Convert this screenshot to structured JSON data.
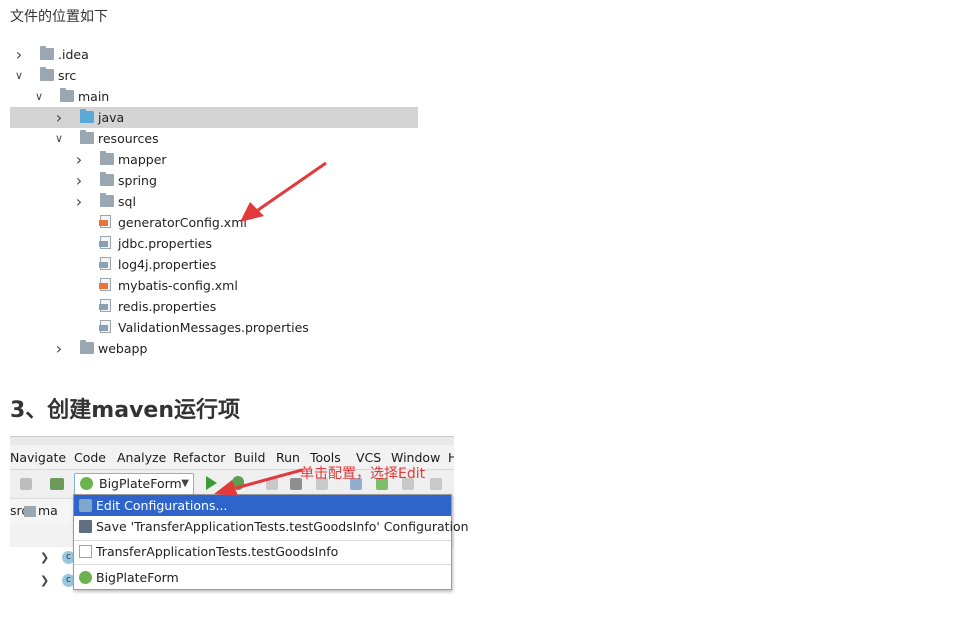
{
  "intro_text": "文件的位置如下",
  "tree": [
    {
      "label": ".idea",
      "icon": "folder-icon",
      "expanded": false,
      "depth": 0
    },
    {
      "label": "src",
      "icon": "folder-icon",
      "expanded": true,
      "depth": 0
    },
    {
      "label": "main",
      "icon": "folder-icon",
      "expanded": true,
      "depth": 1
    },
    {
      "label": "java",
      "icon": "source-folder-icon",
      "expanded": false,
      "depth": 2,
      "selected": true
    },
    {
      "label": "resources",
      "icon": "resources-folder-icon",
      "expanded": true,
      "depth": 2
    },
    {
      "label": "mapper",
      "icon": "folder-icon",
      "expanded": false,
      "depth": 3
    },
    {
      "label": "spring",
      "icon": "folder-icon",
      "expanded": false,
      "depth": 3
    },
    {
      "label": "sql",
      "icon": "folder-icon",
      "expanded": false,
      "depth": 3
    },
    {
      "label": "generatorConfig.xml",
      "icon": "xml-file-icon",
      "depth": 3
    },
    {
      "label": "jdbc.properties",
      "icon": "properties-file-icon",
      "depth": 3
    },
    {
      "label": "log4j.properties",
      "icon": "properties-file-icon",
      "depth": 3
    },
    {
      "label": "mybatis-config.xml",
      "icon": "xml-file-icon",
      "depth": 3
    },
    {
      "label": "redis.properties",
      "icon": "properties-file-icon",
      "depth": 3
    },
    {
      "label": "ValidationMessages.properties",
      "icon": "properties-file-icon",
      "depth": 3
    },
    {
      "label": "webapp",
      "icon": "web-folder-icon",
      "expanded": false,
      "depth": 2
    }
  ],
  "section_heading": "3、创建maven运行项",
  "ide": {
    "menu": [
      "Navigate",
      "Code",
      "Analyze",
      "Refactor",
      "Build",
      "Run",
      "Tools",
      "VCS",
      "Window",
      "H"
    ],
    "run_config": "BigPlateForm",
    "breadcrumb_src": "src",
    "breadcrumb_ma": "ma",
    "dropdown": [
      {
        "label": "Edit Configurations...",
        "icon": "edit-config-icon",
        "highlighted": true
      },
      {
        "label": "Save 'TransferApplicationTests.testGoodsInfo' Configuration",
        "icon": "save-icon"
      },
      {
        "label": "TransferApplicationTests.testGoodsInfo",
        "icon": "test-icon"
      },
      {
        "label": "BigPlateForm",
        "icon": "spring-boot-icon"
      }
    ],
    "lower_badges": [
      "c",
      "c"
    ]
  },
  "annotation": "单击配置，选择Edit",
  "colors": {
    "arrow": "#e2393b",
    "selection": "#d4d4d4",
    "menu_highlight": "#2f65ca"
  }
}
